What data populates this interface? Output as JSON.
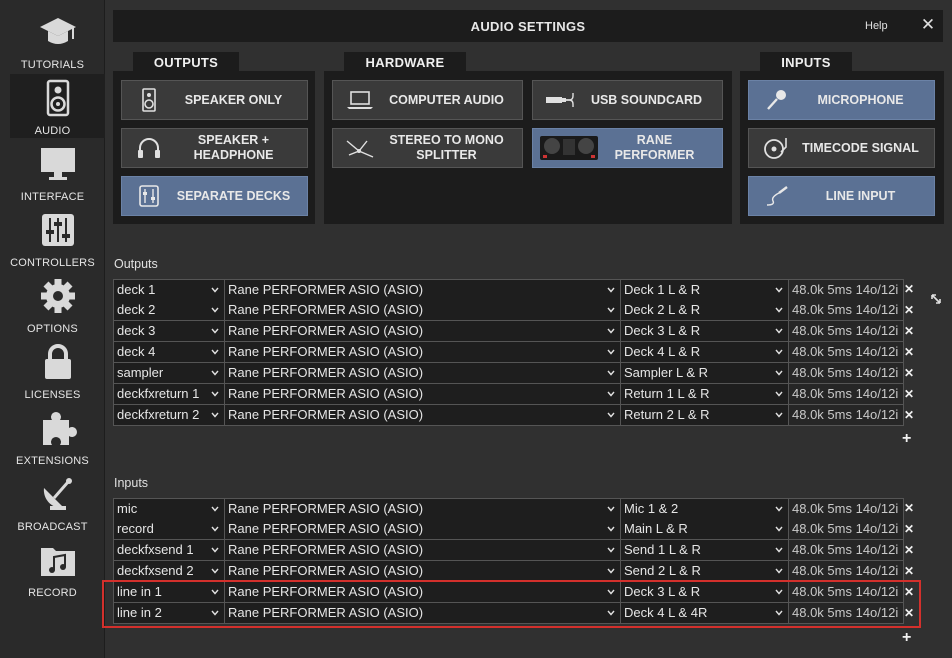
{
  "window": {
    "title": "AUDIO SETTINGS",
    "help": "Help",
    "close": "✕"
  },
  "sidebar": {
    "items": [
      {
        "label": "TUTORIALS",
        "icon": "graduation-cap-icon"
      },
      {
        "label": "AUDIO",
        "icon": "speaker-icon",
        "active": true
      },
      {
        "label": "INTERFACE",
        "icon": "monitor-icon"
      },
      {
        "label": "CONTROLLERS",
        "icon": "sliders-icon"
      },
      {
        "label": "OPTIONS",
        "icon": "gear-icon"
      },
      {
        "label": "LICENSES",
        "icon": "lock-icon"
      },
      {
        "label": "EXTENSIONS",
        "icon": "puzzle-icon"
      },
      {
        "label": "BROADCAST",
        "icon": "satellite-dish-icon"
      },
      {
        "label": "RECORD",
        "icon": "music-folder-icon"
      }
    ]
  },
  "outputs_panel": {
    "tab": "OUTPUTS",
    "buttons": [
      {
        "label": "SPEAKER ONLY",
        "icon": "speaker-icon",
        "selected": false
      },
      {
        "label": "SPEAKER +\nHEADPHONE",
        "icon": "headphone-icon",
        "selected": false
      },
      {
        "label": "SEPARATE DECKS",
        "icon": "mixer-sliders-icon",
        "selected": true
      }
    ]
  },
  "hardware_panel": {
    "tab": "HARDWARE",
    "buttons": [
      {
        "label": "COMPUTER AUDIO",
        "icon": "laptop-icon",
        "selected": false
      },
      {
        "label": "USB SOUNDCARD",
        "icon": "usb-soundcard-icon",
        "selected": false
      },
      {
        "label": "STEREO TO MONO\nSPLITTER",
        "icon": "splitter-cable-icon",
        "selected": false
      },
      {
        "label": "RANE\nPERFORMER",
        "icon": "controller-image-icon",
        "selected": true
      }
    ]
  },
  "inputs_panel": {
    "tab": "INPUTS",
    "buttons": [
      {
        "label": "MICROPHONE",
        "icon": "microphone-icon",
        "selected": true
      },
      {
        "label": "TIMECODE SIGNAL",
        "icon": "turntable-icon",
        "selected": false
      },
      {
        "label": "LINE INPUT",
        "icon": "rca-cable-icon",
        "selected": true
      }
    ]
  },
  "outputs_section": {
    "label": "Outputs",
    "rows": [
      {
        "name": "deck 1",
        "device": "Rane PERFORMER ASIO (ASIO)",
        "channel": "Deck 1 L & R",
        "info": "48.0k 5ms 14o/12i"
      },
      {
        "name": "deck 2",
        "device": "Rane PERFORMER ASIO (ASIO)",
        "channel": "Deck 2 L & R",
        "info": "48.0k 5ms 14o/12i"
      },
      {
        "name": "deck 3",
        "device": "Rane PERFORMER ASIO (ASIO)",
        "channel": "Deck 3 L & R",
        "info": "48.0k 5ms 14o/12i"
      },
      {
        "name": "deck 4",
        "device": "Rane PERFORMER ASIO (ASIO)",
        "channel": "Deck 4 L & R",
        "info": "48.0k 5ms 14o/12i"
      },
      {
        "name": "sampler",
        "device": "Rane PERFORMER ASIO (ASIO)",
        "channel": "Sampler L & R",
        "info": "48.0k 5ms 14o/12i"
      },
      {
        "name": "deckfxreturn 1",
        "device": "Rane PERFORMER ASIO (ASIO)",
        "channel": "Return 1 L & R",
        "info": "48.0k 5ms 14o/12i"
      },
      {
        "name": "deckfxreturn 2",
        "device": "Rane PERFORMER ASIO (ASIO)",
        "channel": "Return 2 L & R",
        "info": "48.0k 5ms 14o/12i"
      }
    ],
    "add": "+"
  },
  "inputs_section": {
    "label": "Inputs",
    "rows": [
      {
        "name": "mic",
        "device": "Rane PERFORMER ASIO (ASIO)",
        "channel": "Mic 1 & 2",
        "info": "48.0k 5ms 14o/12i"
      },
      {
        "name": "record",
        "device": "Rane PERFORMER ASIO (ASIO)",
        "channel": "Main L & R",
        "info": "48.0k 5ms 14o/12i"
      },
      {
        "name": "deckfxsend 1",
        "device": "Rane PERFORMER ASIO (ASIO)",
        "channel": "Send 1 L & R",
        "info": "48.0k 5ms 14o/12i"
      },
      {
        "name": "deckfxsend 2",
        "device": "Rane PERFORMER ASIO (ASIO)",
        "channel": "Send 2 L & R",
        "info": "48.0k 5ms 14o/12i"
      },
      {
        "name": "line in 1",
        "device": "Rane PERFORMER ASIO (ASIO)",
        "channel": "Deck 3 L & R",
        "info": "48.0k 5ms 14o/12i"
      },
      {
        "name": "line in 2",
        "device": "Rane PERFORMER ASIO (ASIO)",
        "channel": "Deck 4 L & 4R",
        "info": "48.0k 5ms 14o/12i"
      }
    ],
    "add": "+"
  },
  "delete_symbol": "✕",
  "colors": {
    "selected_button": "#5b7194",
    "highlight": "#d3302c",
    "panel": "#1c1c1c",
    "background": "#303030"
  }
}
